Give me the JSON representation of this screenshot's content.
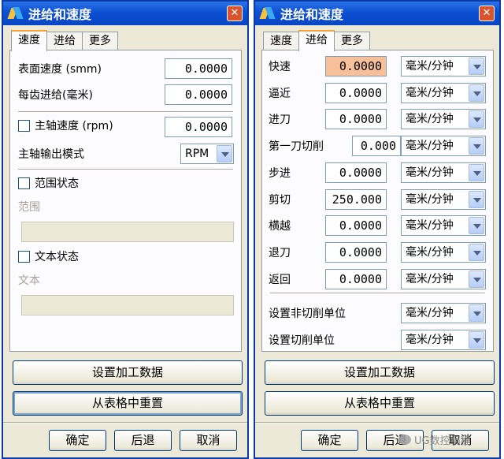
{
  "left_dialog": {
    "title": "进给和速度",
    "tabs": [
      "速度",
      "进给",
      "更多"
    ],
    "surface_speed_label": "表面速度 (smm)",
    "surface_speed_value": "0.0000",
    "feed_per_tooth_label": "每齿进给(毫米)",
    "feed_per_tooth_value": "0.0000",
    "spindle_speed_label": "主轴速度 (rpm)",
    "spindle_speed_value": "0.0000",
    "spindle_output_label": "主轴输出模式",
    "spindle_output_value": "RPM",
    "range_status_label": "范围状态",
    "range_label": "范围",
    "text_status_label": "文本状态",
    "text_label": "文本",
    "set_data_button": "设置加工数据",
    "reset_button": "从表格中重置",
    "ok_button": "确定",
    "back_button": "后退",
    "cancel_button": "取消"
  },
  "right_dialog": {
    "title": "进给和速度",
    "tabs": [
      "速度",
      "进给",
      "更多"
    ],
    "feed_rows": [
      {
        "label": "快速",
        "value": "0.0000",
        "unit": "毫米/分钟"
      },
      {
        "label": "逼近",
        "value": "0.0000",
        "unit": "毫米/分钟"
      },
      {
        "label": "进刀",
        "value": "0.0000",
        "unit": "毫米/分钟"
      },
      {
        "label": "第一刀切削",
        "value": "0.000",
        "unit": "毫米/分钟"
      },
      {
        "label": "步进",
        "value": "0.0000",
        "unit": "毫米/分钟"
      },
      {
        "label": "剪切",
        "value": "250.000",
        "unit": "毫米/分钟"
      },
      {
        "label": "横越",
        "value": "0.0000",
        "unit": "毫米/分钟"
      },
      {
        "label": "退刀",
        "value": "0.0000",
        "unit": "毫米/分钟"
      },
      {
        "label": "返回",
        "value": "0.0000",
        "unit": "毫米/分钟"
      }
    ],
    "non_cut_unit_label": "设置非切削单位",
    "non_cut_unit_value": "毫米/分钟",
    "cut_unit_label": "设置切削单位",
    "cut_unit_value": "毫米/分钟",
    "set_data_button": "设置加工数据",
    "reset_button": "从表格中重置",
    "ok_button": "确定",
    "back_button": "后退",
    "cancel_button": "取消"
  },
  "watermark": "UG数控编程"
}
